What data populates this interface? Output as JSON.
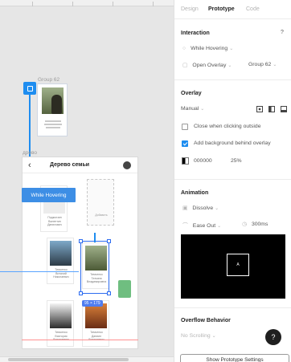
{
  "canvas": {
    "group_label": "Group 62",
    "frame_label": "древо",
    "phone_title": "Дерево семьи",
    "back_glyph": "‹",
    "while_hovering_label": "While Hovering",
    "size_badge": "95 × 179",
    "cards": [
      {
        "caption": "Тимченко\nТатьяна\nВладимировна"
      },
      {
        "caption": "Подколзин\nВалентин\nДанилович"
      },
      {
        "caption": "Добавить"
      },
      {
        "caption": "Тимченко\nВиталий\nНиколаевич"
      },
      {
        "caption": "Тимченко\nТатьяна\nВладимировна"
      },
      {
        "caption": "Тимченко\nВиктория\nВиталиевна"
      },
      {
        "caption": "Тимченко\nДаниил\nВиталиевич"
      }
    ]
  },
  "panel": {
    "tabs": [
      {
        "label": "Design",
        "active": false
      },
      {
        "label": "Prototype",
        "active": true
      },
      {
        "label": "Code",
        "active": false
      }
    ],
    "interaction": {
      "title": "Interaction",
      "help_glyph": "?",
      "trigger": "While Hovering",
      "action": "Open Overlay",
      "target": "Group 62"
    },
    "overlay": {
      "title": "Overlay",
      "position": "Manual",
      "close_outside_label": "Close when clicking outside",
      "close_outside_checked": false,
      "add_background_label": "Add background behind overlay",
      "add_background_checked": true,
      "bg_color": "000000",
      "bg_opacity": "25%"
    },
    "animation": {
      "title": "Animation",
      "type": "Dissolve",
      "easing": "Ease Out",
      "duration": "300ms",
      "preview_label": "A"
    },
    "overflow": {
      "title": "Overflow Behavior",
      "value": "No Scrolling"
    },
    "help_fab": "?",
    "show_settings": "Show Prototype Settings"
  },
  "colors": {
    "accent": "#1e8df0",
    "selection": "#2d6cf0"
  }
}
